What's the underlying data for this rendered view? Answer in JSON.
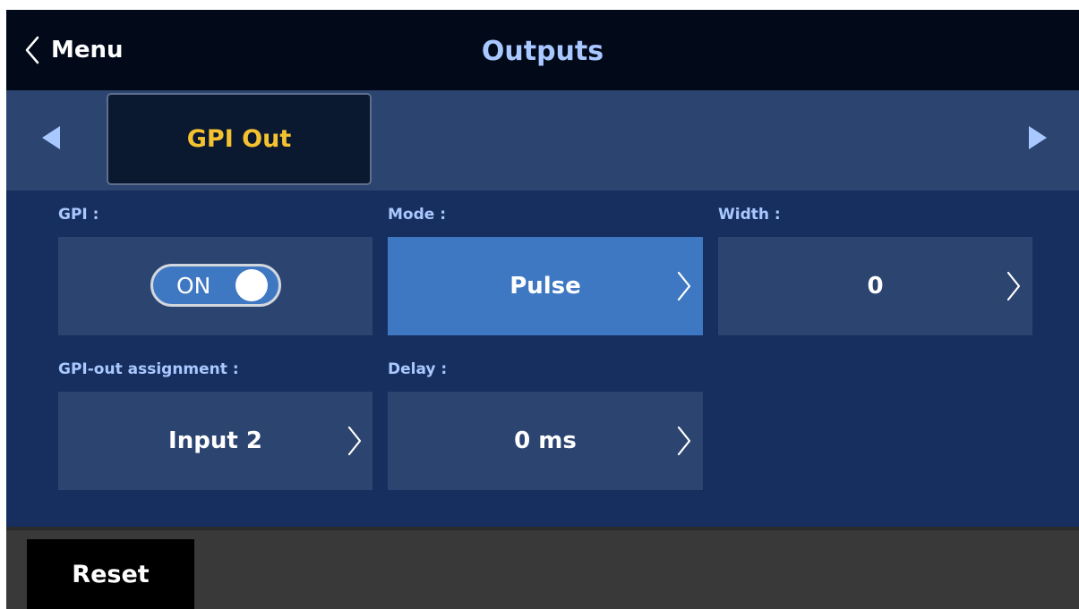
{
  "header": {
    "back_label": "Menu",
    "title": "Outputs"
  },
  "tabs": {
    "active_label": "GPI Out",
    "prev_icon": "triangle-left-icon",
    "next_icon": "triangle-right-icon"
  },
  "fields": {
    "gpi": {
      "label": "GPI :",
      "toggle_text": "ON",
      "state": "on"
    },
    "mode": {
      "label": "Mode :",
      "value": "Pulse"
    },
    "width": {
      "label": "Width :",
      "value": "0"
    },
    "assignment": {
      "label": "GPI-out assignment :",
      "value": "Input 2"
    },
    "delay": {
      "label": "Delay :",
      "value": "0 ms"
    }
  },
  "footer": {
    "reset_label": "Reset"
  },
  "colors": {
    "header_bg": "#020a1a",
    "panel_bg": "#172f5e",
    "tab_bar_bg": "#2c4470",
    "active_tab_text": "#f4c230",
    "label_text": "#a9c8ff",
    "active_field_bg": "#3f78c2",
    "arrow_blue": "#a9c8ff",
    "footer_bg": "#393939"
  }
}
